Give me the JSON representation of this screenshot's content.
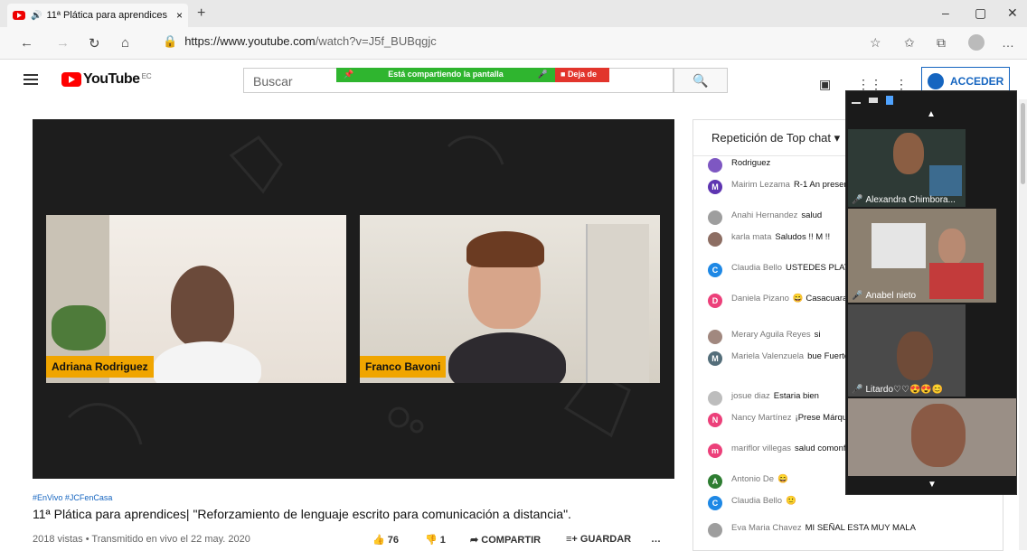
{
  "browser": {
    "tab_title": "11ª Plática para aprendices",
    "tab_close": "×",
    "new_tab": "+",
    "win_min": "–",
    "win_max": "▢",
    "win_close": "✕",
    "url_prefix": "https://www.youtube.com",
    "url_rest": "/watch?v=J5f_BUBqgjc",
    "more": "…"
  },
  "youtube": {
    "logo_word": "YouTube",
    "region": "EC",
    "search_placeholder": "Buscar",
    "sharing_text": "Está compartiendo la pantalla",
    "stop_sharing": "Deja de",
    "login_label": "ACCEDER"
  },
  "video": {
    "participant_left": "Adriana Rodriguez",
    "participant_right": "Franco Bavoni",
    "tags": "#EnVivo #JCFenCasa",
    "title": "11ª Plática para aprendices| \"Reforzamiento de lenguaje escrito para comunicación a distancia\".",
    "meta": "2018 vistas • Transmitido en vivo el 22 may. 2020",
    "likes": "76",
    "dislikes": "1",
    "share_label": "COMPARTIR",
    "save_label": "GUARDAR",
    "more": "…"
  },
  "chat": {
    "header": "Repetición de Top chat",
    "messages": [
      {
        "initial": "",
        "color": "#7e57c2",
        "author": "",
        "text": "Rodriguez"
      },
      {
        "initial": "M",
        "color": "#5e35b1",
        "author": "Mairim Lezama",
        "text": "R-1 An presente saludos"
      },
      {
        "initial": "",
        "color": "#9e9e9e",
        "author": "Anahi Hernandez",
        "text": "salud"
      },
      {
        "initial": "",
        "color": "#8d6e63",
        "author": "karla mata",
        "text": "Saludos !! M !!"
      },
      {
        "initial": "C",
        "color": "#1e88e5",
        "author": "Claudia Bello",
        "text": "USTEDES PLATICA"
      },
      {
        "initial": "D",
        "color": "#ec407a",
        "author": "Daniela Pizano",
        "text": "Casacuaran Gto."
      },
      {
        "initial": "",
        "color": "#a1887f",
        "author": "Merary Aguila Reyes",
        "text": "si"
      },
      {
        "initial": "M",
        "color": "#546e7a",
        "author": "Mariela Valenzuela",
        "text": "bue Fuerte"
      },
      {
        "initial": "",
        "color": "#bdbdbd",
        "author": "josue diaz",
        "text": "Estaria bien"
      },
      {
        "initial": "N",
        "color": "#ec407a",
        "author": "Nancy Martínez",
        "text": "¡Prese Márquez, Pénjamo, Gto"
      },
      {
        "initial": "m",
        "color": "#ec407a",
        "author": "mariflor villegas",
        "text": "salud comonfort"
      },
      {
        "initial": "A",
        "color": "#2e7d32",
        "author": "Antonio De",
        "text": ""
      },
      {
        "initial": "C",
        "color": "#1e88e5",
        "author": "Claudia Bello",
        "text": ""
      },
      {
        "initial": "",
        "color": "#9e9e9e",
        "author": "Eva Maria Chavez",
        "text": "MI SEÑAL ESTA MUY MALA"
      }
    ]
  },
  "meeting": {
    "participants": [
      {
        "name": "Alexandra Chimbora..."
      },
      {
        "name": "Anabel nieto"
      },
      {
        "name": "Litardo♡♡😍😍😊"
      },
      {
        "name": ""
      }
    ]
  }
}
